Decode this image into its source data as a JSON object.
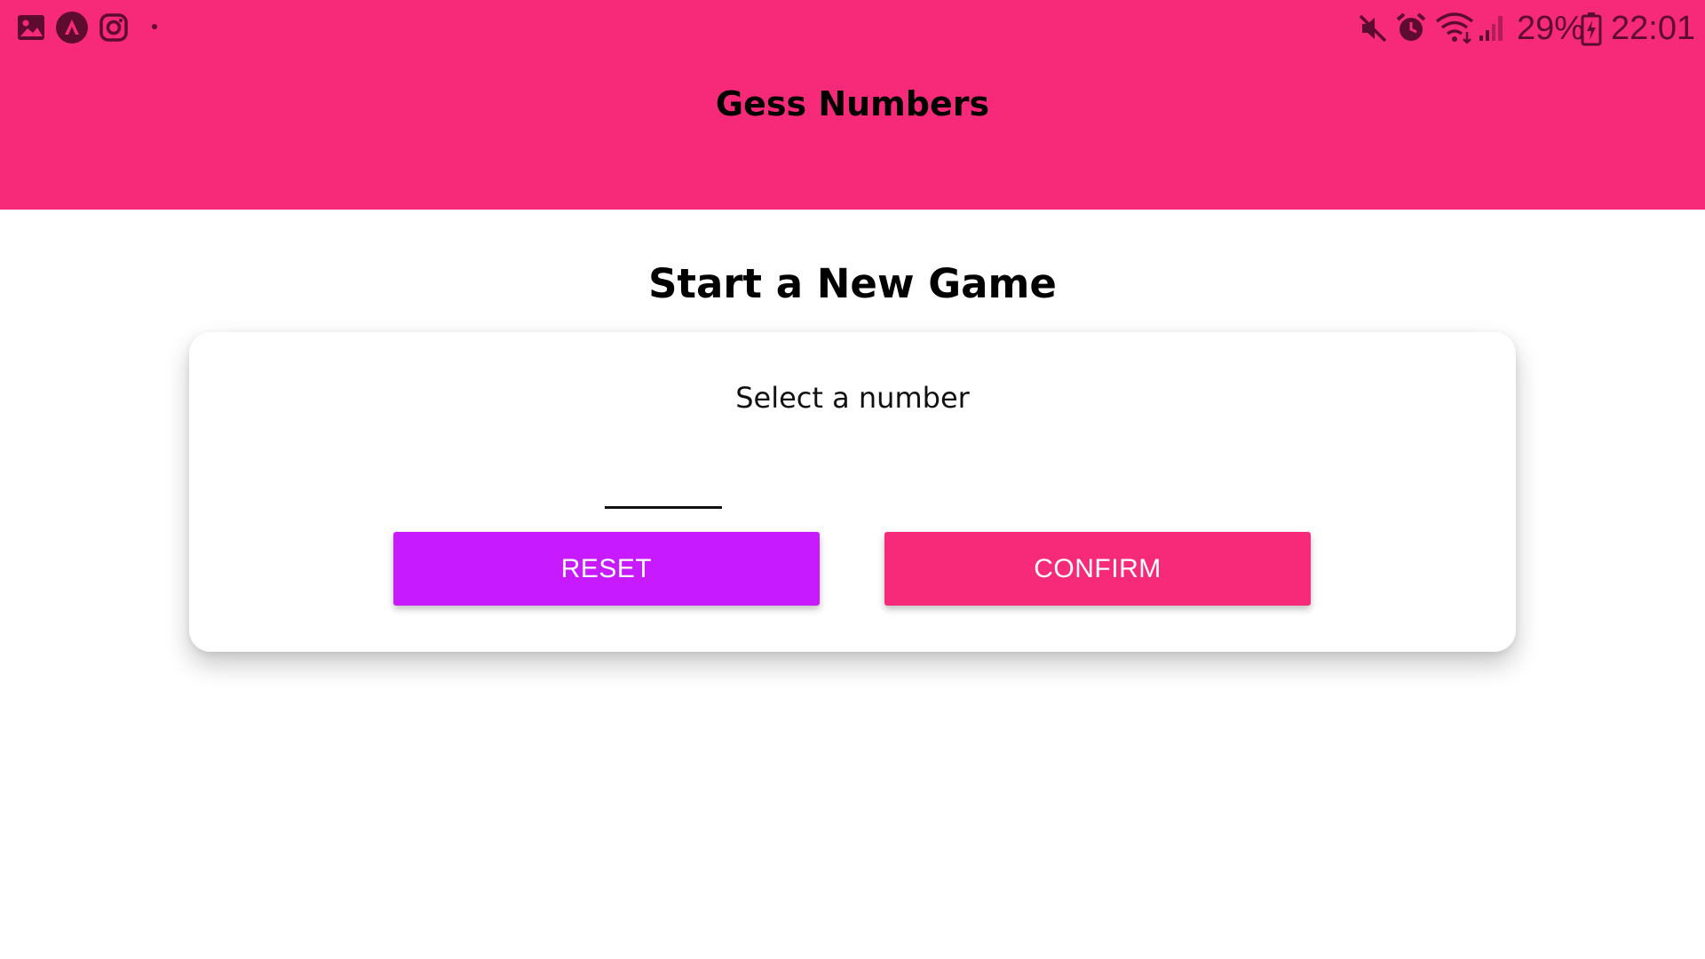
{
  "colors": {
    "header_bg": "#f72a7a",
    "reset_button": "#c71aff",
    "confirm_button": "#f72a7a",
    "status_icon": "#5e0b30"
  },
  "status_bar": {
    "left_icons": [
      "gallery-icon",
      "app-logo-icon",
      "instagram-icon",
      "notification-dot-icon"
    ],
    "right_icons": [
      "mute-icon",
      "alarm-icon",
      "wifi-icon",
      "signal-icon",
      "battery-icon"
    ],
    "battery_percent": "29%",
    "time": "22:01"
  },
  "header": {
    "title": "Gess Numbers"
  },
  "main": {
    "title": "Start a New Game",
    "card": {
      "label": "Select a number",
      "input_value": "",
      "reset_label": "RESET",
      "confirm_label": "CONFIRM"
    }
  }
}
